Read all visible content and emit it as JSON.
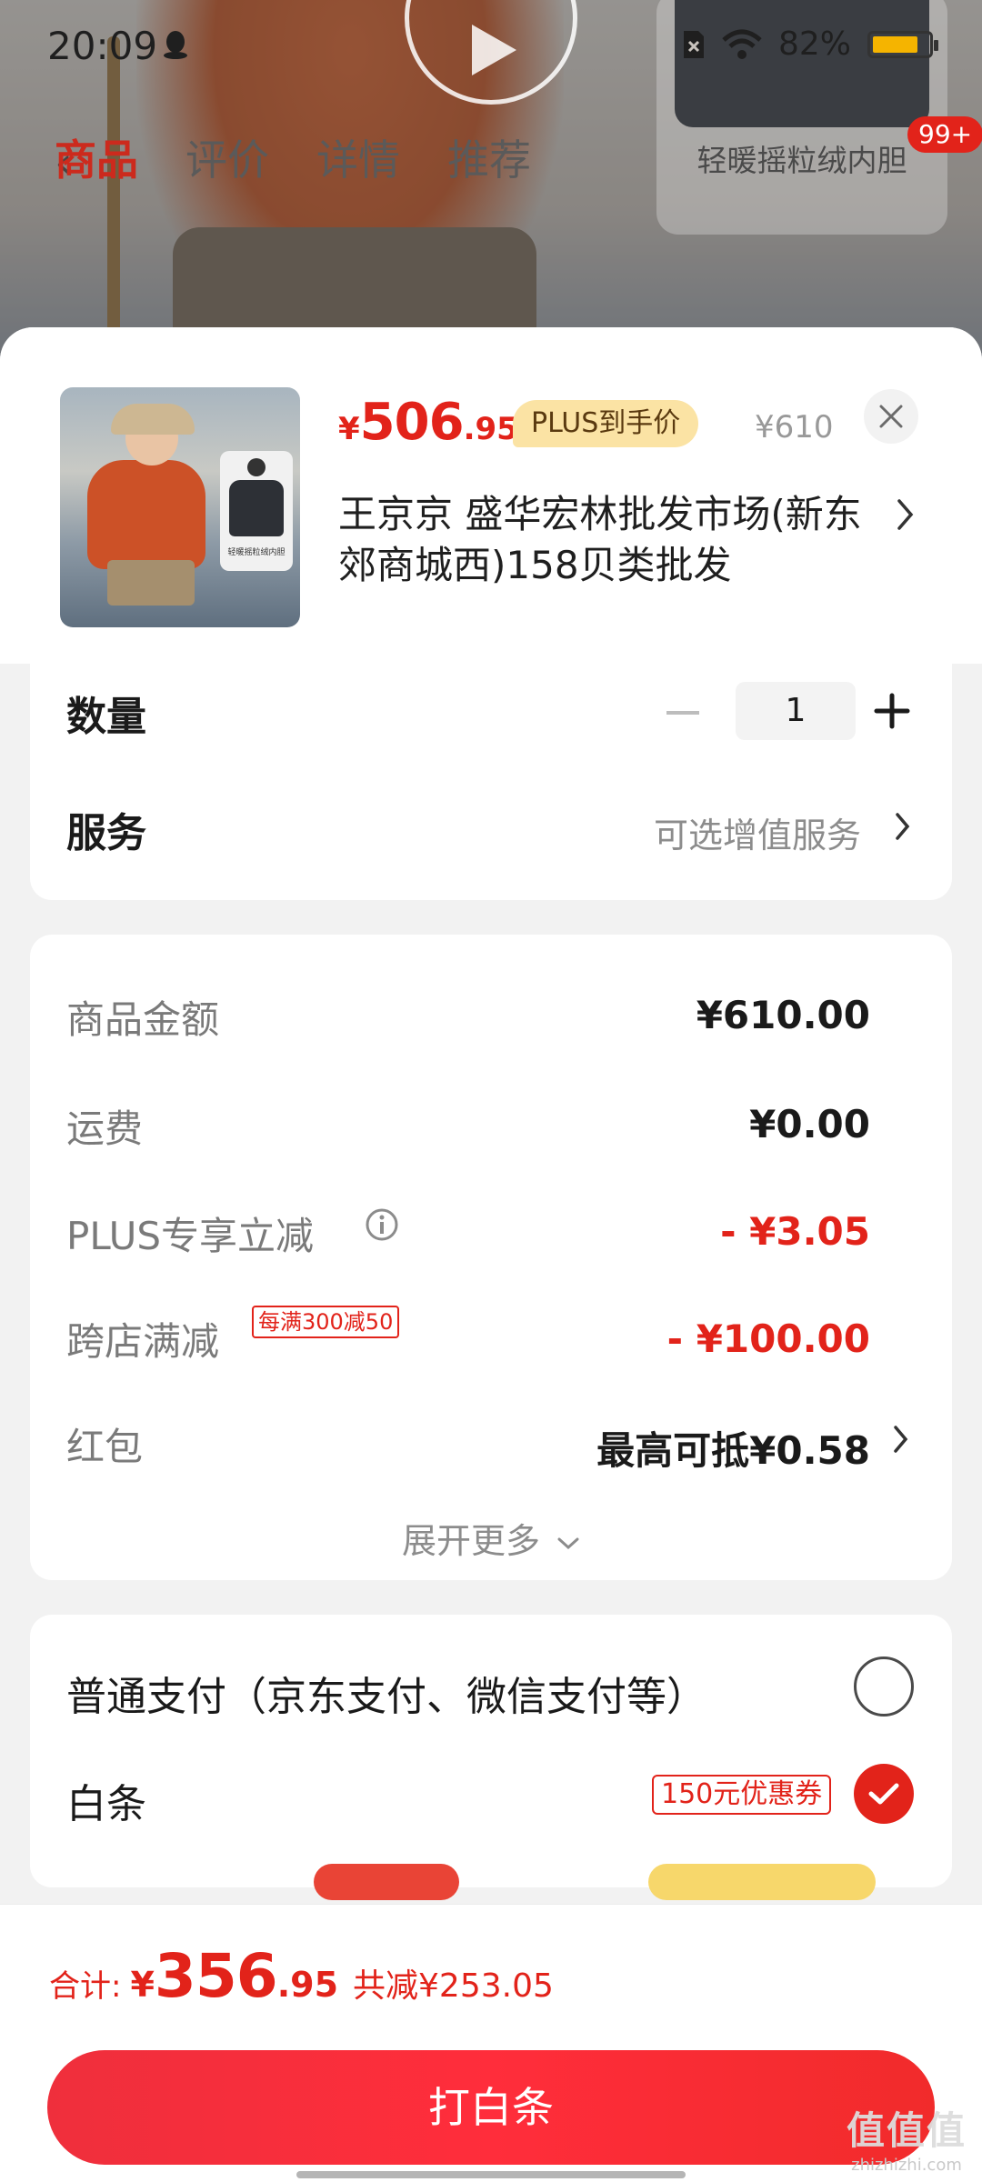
{
  "status_bar": {
    "time": "20:09",
    "battery_percent": "82%",
    "battery_level": 0.82
  },
  "background": {
    "tabs": [
      "商品",
      "评价",
      "详情",
      "推荐"
    ],
    "active_tab": "商品",
    "thumb_label": "轻暖摇粒绒内胆",
    "badge": "99+"
  },
  "product": {
    "price_symbol": "¥",
    "price_int": "506",
    "price_dec": ".95",
    "plus_badge": "PLUS到手价",
    "original_price": "¥610",
    "image_card_text": "轻暖摇粒绒内胆",
    "store": "王京京  盛华宏林批发市场(新东郊商城西)158贝类批发"
  },
  "quantity": {
    "label": "数量",
    "value": "1"
  },
  "service": {
    "label": "服务",
    "value": "可选增值服务"
  },
  "fees": {
    "goods_amount": {
      "label": "商品金额",
      "value": "¥610.00"
    },
    "shipping": {
      "label": "运费",
      "value": "¥0.00"
    },
    "plus_discount": {
      "label": "PLUS专享立减",
      "value": "- ¥3.05"
    },
    "cross_store": {
      "label": "跨店满减",
      "tag": "每满300减50",
      "value": "- ¥100.00"
    },
    "red_packet": {
      "label": "红包",
      "value": "最高可抵¥0.58"
    },
    "expand_label": "展开更多"
  },
  "payment": {
    "normal": {
      "label": "普通支付（京东支付、微信支付等）",
      "selected": false
    },
    "baitiao": {
      "label": "白条",
      "coupon": "150元优惠券",
      "selected": true
    }
  },
  "footer": {
    "total_label": "合计:",
    "total_symbol": "¥",
    "total_int": "356",
    "total_dec": ".95",
    "total_saved": "共减¥253.05",
    "submit_label": "打白条"
  },
  "watermark": {
    "main": "值值值",
    "sub": "zhizhizhi.com"
  },
  "colors": {
    "accent": "#e2231a",
    "plus_badge_bg": "#fbe3a4",
    "sheet_bg": "#f2f2f2"
  }
}
